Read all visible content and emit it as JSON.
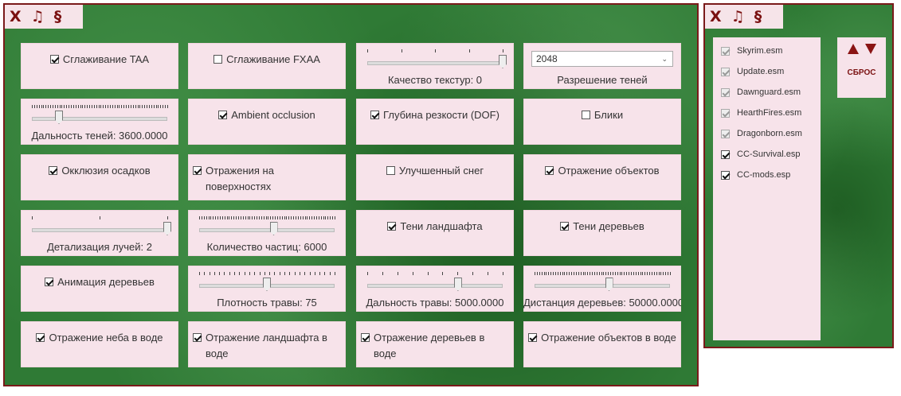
{
  "main_window": {
    "titlebar": {
      "close": "X",
      "music": "♫",
      "section": "§"
    },
    "cards": [
      {
        "type": "check",
        "label": "Сглаживание TAA",
        "checked": true
      },
      {
        "type": "check",
        "label": "Сглаживание FXAA",
        "checked": false
      },
      {
        "type": "slider",
        "label": "Качество текстур: 0",
        "value": 1.0,
        "ticks": 5
      },
      {
        "type": "select",
        "label": "Разрешение теней",
        "selected": "2048"
      },
      {
        "type": "slider",
        "label": "Дальность теней: 3600.0000",
        "value": 0.2,
        "ticks": 60
      },
      {
        "type": "check",
        "label": "Ambient occlusion",
        "checked": true
      },
      {
        "type": "check",
        "label": "Глубина резкости (DOF)",
        "checked": true
      },
      {
        "type": "check",
        "label": "Блики",
        "checked": false
      },
      {
        "type": "check",
        "label": "Окклюзия осадков",
        "checked": true
      },
      {
        "type": "check",
        "label": "Отражения на поверхностях",
        "checked": true
      },
      {
        "type": "check",
        "label": "Улучшенный снег",
        "checked": false
      },
      {
        "type": "check",
        "label": "Отражение объектов",
        "checked": true
      },
      {
        "type": "slider",
        "label": "Детализация лучей: 2",
        "value": 1.0,
        "ticks": 3
      },
      {
        "type": "slider",
        "label": "Количество частиц: 6000",
        "value": 0.55,
        "ticks": 60
      },
      {
        "type": "check",
        "label": "Тени ландшафта",
        "checked": true
      },
      {
        "type": "check",
        "label": "Тени деревьев",
        "checked": true
      },
      {
        "type": "check",
        "label": "Анимация деревьев",
        "checked": true
      },
      {
        "type": "slider",
        "label": "Плотность травы: 75",
        "value": 0.5,
        "ticks": 28
      },
      {
        "type": "slider",
        "label": "Дальность травы: 5000.0000",
        "value": 0.67,
        "ticks": 10
      },
      {
        "type": "slider",
        "label": "Дистанция деревьев: 50000.0000",
        "value": 0.55,
        "ticks": 60
      },
      {
        "type": "check",
        "label": "Отражение неба в воде",
        "checked": true
      },
      {
        "type": "check",
        "label": "Отражение ландшафта в воде",
        "checked": true
      },
      {
        "type": "check",
        "label": "Отражение деревьев в воде",
        "checked": true
      },
      {
        "type": "check",
        "label": "Отражение объектов в воде",
        "checked": true
      }
    ]
  },
  "side_window": {
    "titlebar": {
      "close": "X",
      "music": "♫",
      "section": "§"
    },
    "plugins": [
      {
        "name": "Skyrim.esm",
        "checked": true,
        "locked": true
      },
      {
        "name": "Update.esm",
        "checked": true,
        "locked": true
      },
      {
        "name": "Dawnguard.esm",
        "checked": true,
        "locked": true
      },
      {
        "name": "HearthFires.esm",
        "checked": true,
        "locked": true
      },
      {
        "name": "Dragonborn.esm",
        "checked": true,
        "locked": true
      },
      {
        "name": "CC-Survival.esp",
        "checked": true,
        "locked": false
      },
      {
        "name": "CC-mods.esp",
        "checked": true,
        "locked": false
      }
    ],
    "reset_label": "СБРОС"
  },
  "colors": {
    "accent": "#7a1010",
    "background": "#2f7a35",
    "card": "#f7e3ea"
  },
  "icons": {
    "close": "close-icon",
    "music": "music-note-icon",
    "section": "section-sign-icon",
    "up": "arrow-up-icon",
    "down": "arrow-down-icon"
  }
}
